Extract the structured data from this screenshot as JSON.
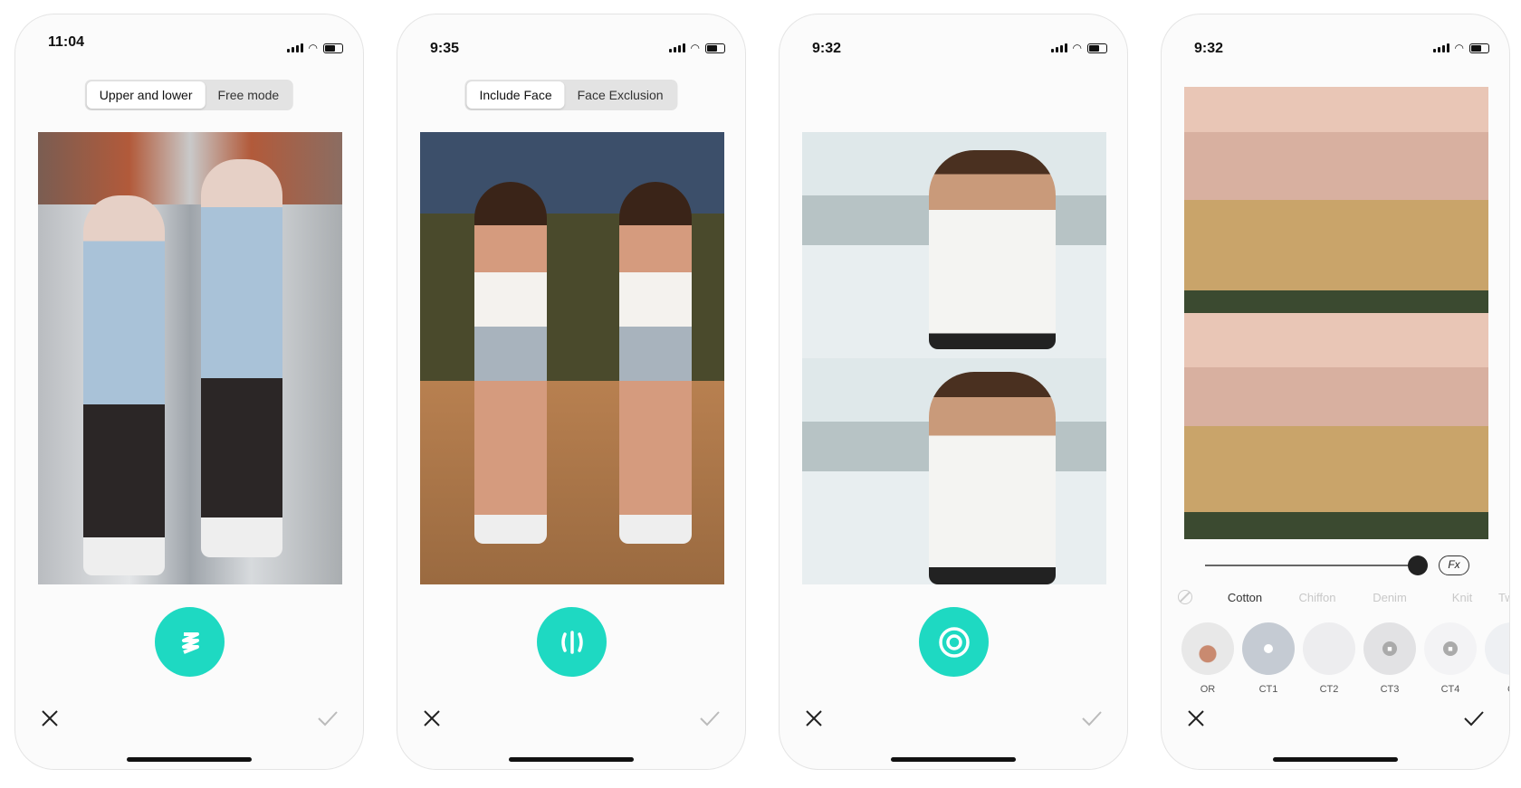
{
  "screens": [
    {
      "time": "11:04",
      "segments": [
        "Upper and lower",
        "Free mode"
      ],
      "active_segment": 0,
      "action_icon": "zigzag-icon"
    },
    {
      "time": "9:35",
      "segments": [
        "Include Face",
        "Face Exclusion"
      ],
      "active_segment": 0,
      "action_icon": "split-lines-icon"
    },
    {
      "time": "9:32",
      "action_icon": "target-ring-icon"
    },
    {
      "time": "9:32",
      "slider_value": 1.0,
      "fx_label": "Fx",
      "fabric_tabs": [
        "Cotton",
        "Chiffon",
        "Denim",
        "Knit",
        "Tw"
      ],
      "active_tab": 0,
      "swatches": [
        {
          "label": "OR"
        },
        {
          "label": "CT1"
        },
        {
          "label": "CT2"
        },
        {
          "label": "CT3"
        },
        {
          "label": "CT4"
        },
        {
          "label": "C"
        }
      ]
    }
  ],
  "colors": {
    "accent": "#1ed9c2",
    "background": "#fbfbfb"
  }
}
